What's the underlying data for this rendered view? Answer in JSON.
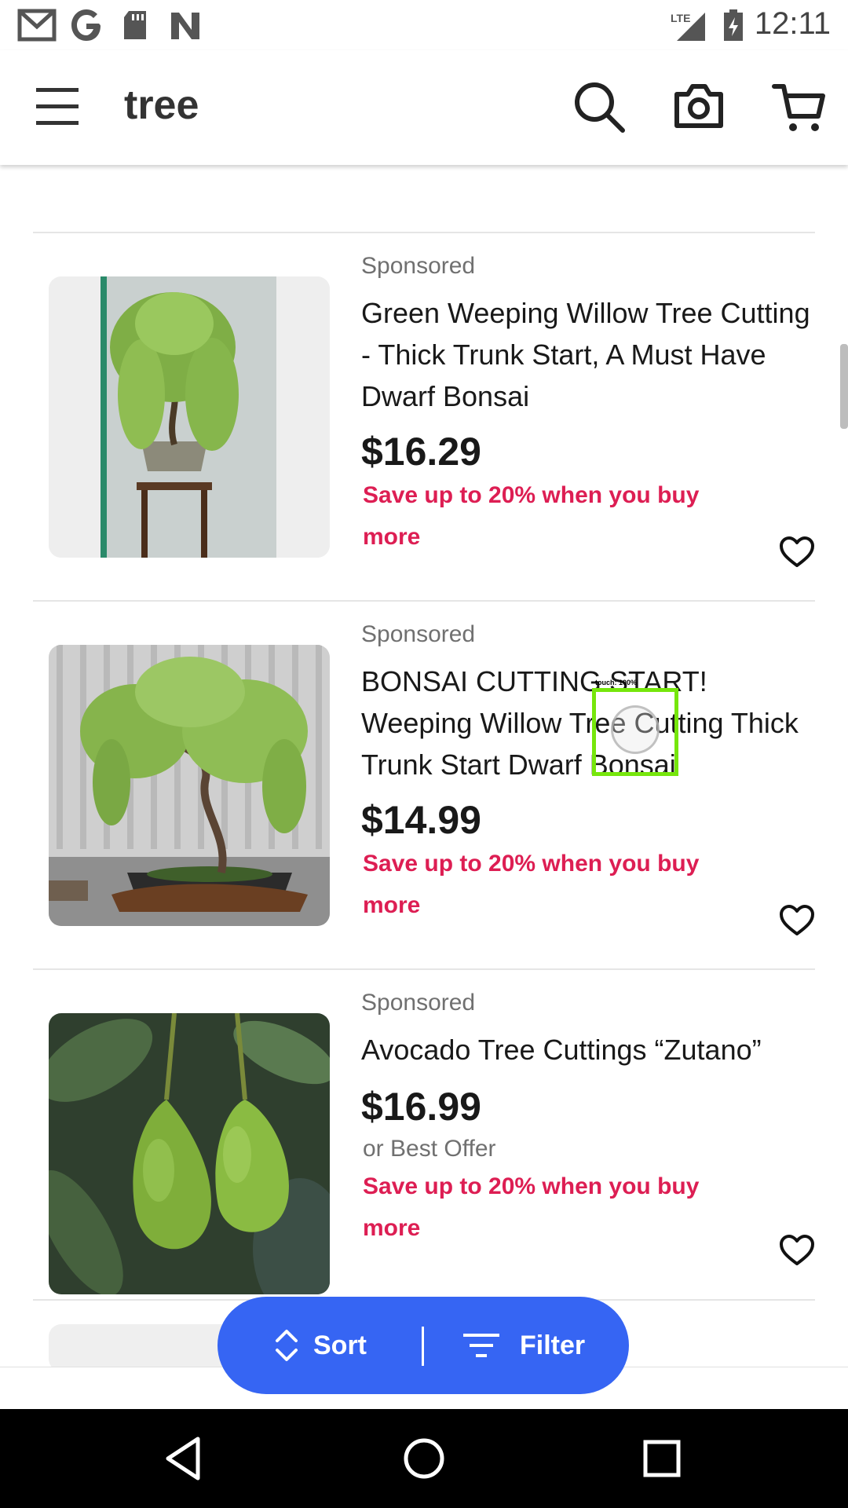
{
  "status_bar": {
    "time": "12:11",
    "network": "LTE",
    "left_icons": [
      "gmail-icon",
      "google-icon",
      "sd-card-icon",
      "n-icon"
    ]
  },
  "app_bar": {
    "search_term": "tree",
    "icons": [
      "menu-icon",
      "search-icon",
      "camera-icon",
      "cart-icon"
    ]
  },
  "results": [
    {
      "sponsored": "Sponsored",
      "title": "Green Weeping Willow Tree Cutting - Thick Trunk Start, A Must Have Dwarf Bonsai",
      "price": "$16.29",
      "best_offer": "",
      "promo": "Save up to 20% when you buy more"
    },
    {
      "sponsored": "Sponsored",
      "title": "BONSAI CUTTING START! Weeping Willow Tree Cutting Thick Trunk Start Dwarf Bonsai",
      "price": "$14.99",
      "best_offer": "",
      "promo": "Save up to 20% when you buy more"
    },
    {
      "sponsored": "Sponsored",
      "title": "Avocado Tree Cuttings “Zutano”",
      "price": "$16.99",
      "best_offer": "or Best Offer",
      "promo": "Save up to 20% when you buy more"
    }
  ],
  "sort_filter": {
    "sort_label": "Sort",
    "filter_label": "Filter"
  },
  "touch_indicator": {
    "label": "touch: 100%"
  },
  "colors": {
    "accent": "#3665f3",
    "promo": "#dd1e53",
    "touch_box": "#76e60c"
  },
  "nav_bar": {
    "icons": [
      "back-icon",
      "home-icon",
      "recents-icon"
    ]
  }
}
